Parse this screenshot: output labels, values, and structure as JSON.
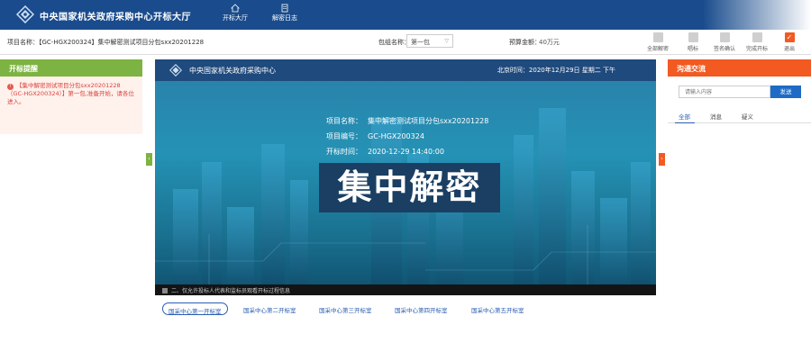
{
  "header": {
    "title": "中央国家机关政府采购中心开标大厅",
    "nav": [
      {
        "label": "开标大厅",
        "icon": "home-icon"
      },
      {
        "label": "解密日志",
        "icon": "document-icon"
      }
    ]
  },
  "info": {
    "project_label": "项目名称：【GC-HGX200324】集中解密测试项目分包sxx20201228",
    "bidder_label": "包组名称：",
    "bidder_value": "第一包",
    "budget_label": "预算金额：",
    "budget_value": "40万元",
    "tools": [
      {
        "label": "全部解密"
      },
      {
        "label": "唱标"
      },
      {
        "label": "签名确认"
      },
      {
        "label": "完成开标"
      },
      {
        "label": "退出"
      }
    ]
  },
  "left": {
    "title": "开标提醒",
    "message": "【集中解密测试项目分包sxx20201228（GC-HGX200324）】第一包,准备开始，请各位进入。"
  },
  "center": {
    "title": "中央国家机关政府采购中心",
    "clock": "北京时间：2020年12月29日 星期二 下午",
    "project_name_label": "项目名称：",
    "project_name_value": "集中解密测试项目分包sxx20201228",
    "project_code_label": "项目编号：",
    "project_code_value": "GC-HGX200324",
    "open_time_label": "开标时间：",
    "open_time_value": "2020-12-29 14:40:00",
    "stage": "集中解密",
    "ticker": "二、仅允许投标人代表和监标员观看开标过程信息"
  },
  "rooms": [
    {
      "label": "国采中心第一开标室"
    },
    {
      "label": "国采中心第二开标室"
    },
    {
      "label": "国采中心第三开标室"
    },
    {
      "label": "国采中心第四开标室"
    },
    {
      "label": "国采中心第五开标室"
    }
  ],
  "right": {
    "title": "沟通交流",
    "search_placeholder": "请输入内容",
    "search_label": "发送",
    "tabs": [
      {
        "label": "全部"
      },
      {
        "label": "消息"
      },
      {
        "label": "疑义"
      }
    ]
  },
  "colors": {
    "header_bg": "#1a4c8d",
    "left_accent": "#7cb342",
    "right_accent": "#f25a22",
    "link_blue": "#2a5db0"
  }
}
